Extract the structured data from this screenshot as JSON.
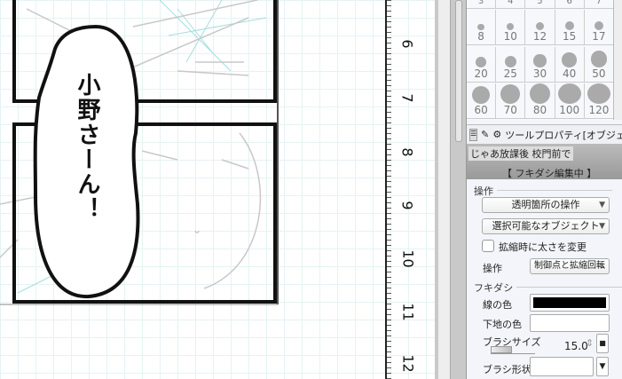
{
  "canvas": {
    "balloon_text": "小野さーん！"
  },
  "ruler": {
    "numbers": [
      "6",
      "7",
      "8",
      "9",
      "10",
      "11",
      "12"
    ]
  },
  "brush_sizes": {
    "top_row": [
      "3",
      "4",
      "5",
      "6",
      "7"
    ],
    "rows": [
      [
        "8",
        "10",
        "12",
        "15",
        "17"
      ],
      [
        "20",
        "25",
        "30",
        "40",
        "50"
      ],
      [
        "60",
        "70",
        "80",
        "100",
        "120"
      ]
    ]
  },
  "tool_property": {
    "title": "ツールプロパティ[オブジェク",
    "preview_text": "じゃあ放課後 校門前で",
    "preview_status": "【 フキダシ編集中 】",
    "section_operation": "操作",
    "transparent_op": "透明箇所の操作",
    "selectable_objects": "選択可能なオブジェクト",
    "scale_thickness": "拡縮時に太さを変更",
    "scale_thickness_checked": false,
    "operation_label": "操作",
    "operation_value": "制御点と拡縮回転",
    "section_balloon": "フキダシ",
    "line_color_label": "線の色",
    "line_color": "#000000",
    "fill_color_label": "下地の色",
    "fill_color": "#ffffff",
    "brush_size_label": "ブラシサイズ",
    "brush_size_value": "15.0",
    "brush_shape_label": "ブラシ形状",
    "brush_shape_value": ""
  }
}
